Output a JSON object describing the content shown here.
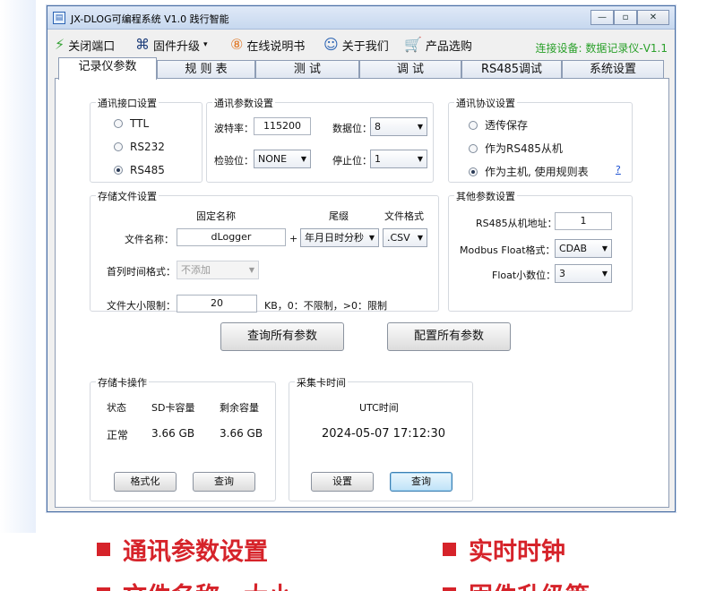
{
  "window": {
    "title": "JX-DLOG可编程系统 V1.0 践行智能",
    "app_icon": "doc-icon",
    "controls": {
      "minimize": "—",
      "restore": "▫",
      "close": "✕"
    }
  },
  "menubar": {
    "items": [
      {
        "label": "关闭端口",
        "icon": "plug-icon",
        "glyph": "⚡"
      },
      {
        "label": "固件升级",
        "icon": "command-icon",
        "glyph": "⌘",
        "dropdown": "▾"
      },
      {
        "label": "在线说明书",
        "icon": "info-icon",
        "glyph": "⑧"
      },
      {
        "label": "关于我们",
        "icon": "users-icon",
        "glyph": "☺"
      },
      {
        "label": "产品选购",
        "icon": "cart-icon",
        "glyph": "🛒"
      }
    ],
    "connection_status": "连接设备: 数据记录仪-V1.1",
    "status_color": "#2aa02a"
  },
  "tabs": [
    "记录仪参数",
    "规 则 表",
    "测  试",
    "调  试",
    "RS485调试",
    "系统设置"
  ],
  "active_tab": 0,
  "comm_interface": {
    "title": "通讯接口设置",
    "options": [
      "TTL",
      "RS232",
      "RS485"
    ],
    "selected": "RS485"
  },
  "comm_params": {
    "title": "通讯参数设置",
    "baud_label": "波特率：",
    "baud_value": "115200",
    "databits_label": "数据位：",
    "databits_value": "8",
    "parity_label": "检验位：",
    "parity_value": "NONE",
    "stopbits_label": "停止位：",
    "stopbits_value": "1"
  },
  "protocol": {
    "title": "通讯协议设置",
    "options": [
      "透传保存",
      "作为RS485从机",
      "作为主机, 使用规则表"
    ],
    "selected": "作为主机, 使用规则表",
    "help_link": "?"
  },
  "storage_file": {
    "title": "存储文件设置",
    "col_fixed": "固定名称",
    "col_suffix": "尾缀",
    "col_format": "文件格式",
    "filename_label": "文件名称：",
    "filename_value": "dLogger",
    "plus": "+",
    "suffix_value": "年月日时分秒",
    "format_value": ".CSV",
    "first_col_label": "首列时间格式：",
    "first_col_value": "不添加",
    "size_label": "文件大小限制：",
    "size_value": "20",
    "size_hint": "KB，0：不限制，>0：限制"
  },
  "other_params": {
    "title": "其他参数设置",
    "slave_addr_label": "RS485从机地址：",
    "slave_addr_value": "1",
    "float_fmt_label": "Modbus Float格式：",
    "float_fmt_value": "CDAB",
    "float_dec_label": "Float小数位：",
    "float_dec_value": "3"
  },
  "actions": {
    "query_all": "查询所有参数",
    "config_all": "配置所有参数"
  },
  "sd_card": {
    "title": "存储卡操作",
    "headers": [
      "状态",
      "SD卡容量",
      "剩余容量"
    ],
    "values": [
      "正常",
      "3.66 GB",
      "3.66 GB"
    ],
    "format_btn": "格式化",
    "query_btn": "查询"
  },
  "clock": {
    "title": "采集卡时间",
    "utc_label": "UTC时间",
    "time_value": "2024-05-07 17:12:30",
    "set_btn": "设置",
    "query_btn": "查询"
  },
  "promo": {
    "line1_left": "通讯参数设置",
    "line1_right": "实时时钟",
    "line2_left": "文件名称、大小",
    "line2_right": "固件升级等"
  }
}
